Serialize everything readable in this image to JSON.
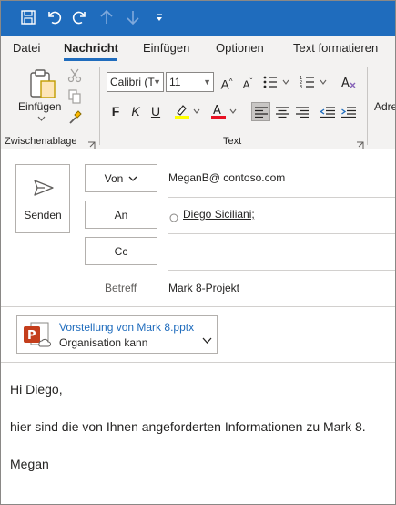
{
  "quick_access": {
    "icons": [
      "save-icon",
      "undo-icon",
      "redo-icon",
      "up-arrow-icon",
      "down-arrow-icon",
      "customize-icon"
    ]
  },
  "tabs": [
    {
      "label": "Datei"
    },
    {
      "label": "Nachricht"
    },
    {
      "label": "Einfügen"
    },
    {
      "label": "Optionen"
    },
    {
      "label": "Text formatieren"
    }
  ],
  "active_tab": "Nachricht",
  "ribbon": {
    "paste_label": "Einfügen",
    "clipboard_group_label": "Zwischenablage",
    "font_name": "Calibri (T",
    "font_size": "11",
    "text_group_label": "Text",
    "bold": "F",
    "italic": "K",
    "underline": "U",
    "address_partial": "Adre"
  },
  "compose": {
    "send_label": "Senden",
    "from_label": "Von",
    "from_value": "MeganB@ contoso.com",
    "to_label": "An",
    "to_value": "Diego Siciliani;",
    "cc_label": "Cc",
    "subject_label": "Betreff",
    "subject_value": "Mark 8-Projekt"
  },
  "attachment": {
    "name": "Vorstellung von Mark 8.pptx",
    "subtitle": "Organisation kann"
  },
  "body": {
    "lines": [
      "Hi Diego,",
      "hier sind die von Ihnen angeforderten Informationen zu Mark 8.",
      "Megan"
    ]
  },
  "colors": {
    "accent": "#1f6cbd",
    "highlight": "#ffff00",
    "font_color": "#e81123",
    "powerpoint": "#c43e1c"
  }
}
